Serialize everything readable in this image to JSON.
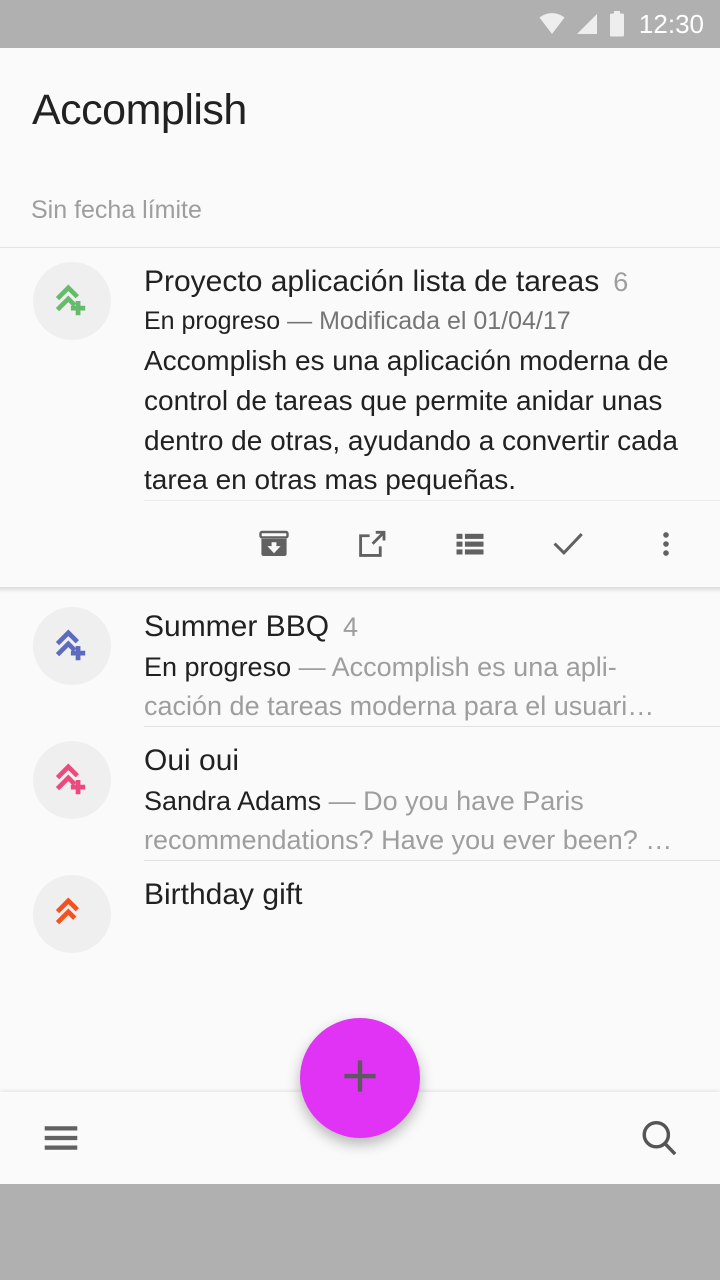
{
  "statusbar": {
    "time": "12:30",
    "icons": [
      "wifi-icon",
      "cell-signal-icon",
      "battery-icon"
    ]
  },
  "header": {
    "app_title": "Accomplish",
    "section_label": "Sin fecha límite"
  },
  "list": {
    "items": [
      {
        "id": "proyecto-aplicacion-lista-de-tareas",
        "avatar_icon": "double-chevron-up-plus-icon",
        "avatar_color": "#66bb6a",
        "title": "Proyecto aplicación lista de tareas",
        "count": "6",
        "meta_strong": "En progreso",
        "meta_rest": " — Modificada el 01/04/17",
        "body": "Accomplish es una aplicación moderna de control de tareas que permite anidar unas dentro de otras, ayudando a convertir cada tarea en otras mas pequeñas.",
        "expanded": true
      },
      {
        "id": "summer-bbq",
        "avatar_icon": "double-chevron-up-plus-icon",
        "avatar_color": "#5c6bc0",
        "title": "Summer BBQ",
        "count": "4",
        "snippet_strong": "En progreso",
        "snippet_rest": " — Accomplish es una apli-cación de tareas moderna para el usuari…",
        "expanded": false
      },
      {
        "id": "oui-oui",
        "avatar_icon": "double-chevron-up-plus-icon",
        "avatar_color": "#ec4a7e",
        "title": "Oui oui",
        "count": "",
        "snippet_strong": "Sandra Adams",
        "snippet_rest": " — Do you have Paris recommendations? Have you ever been? …",
        "expanded": false
      },
      {
        "id": "birthday-gift",
        "avatar_icon": "double-chevron-up-icon",
        "avatar_color": "#f4511e",
        "title": "Birthday gift",
        "count": "",
        "snippet_strong": "",
        "snippet_rest": "",
        "expanded": false
      }
    ]
  },
  "card_actions": [
    {
      "name": "archive-icon",
      "label": "Archive"
    },
    {
      "name": "open-in-new-icon",
      "label": "Open"
    },
    {
      "name": "list-view-icon",
      "label": "List"
    },
    {
      "name": "check-icon",
      "label": "Done"
    },
    {
      "name": "more-vert-icon",
      "label": "More"
    }
  ],
  "bottom_bar": {
    "menu_icon": "hamburger-menu-icon",
    "search_icon": "search-icon"
  },
  "fab": {
    "icon": "plus-icon",
    "color": "#e033f5"
  }
}
